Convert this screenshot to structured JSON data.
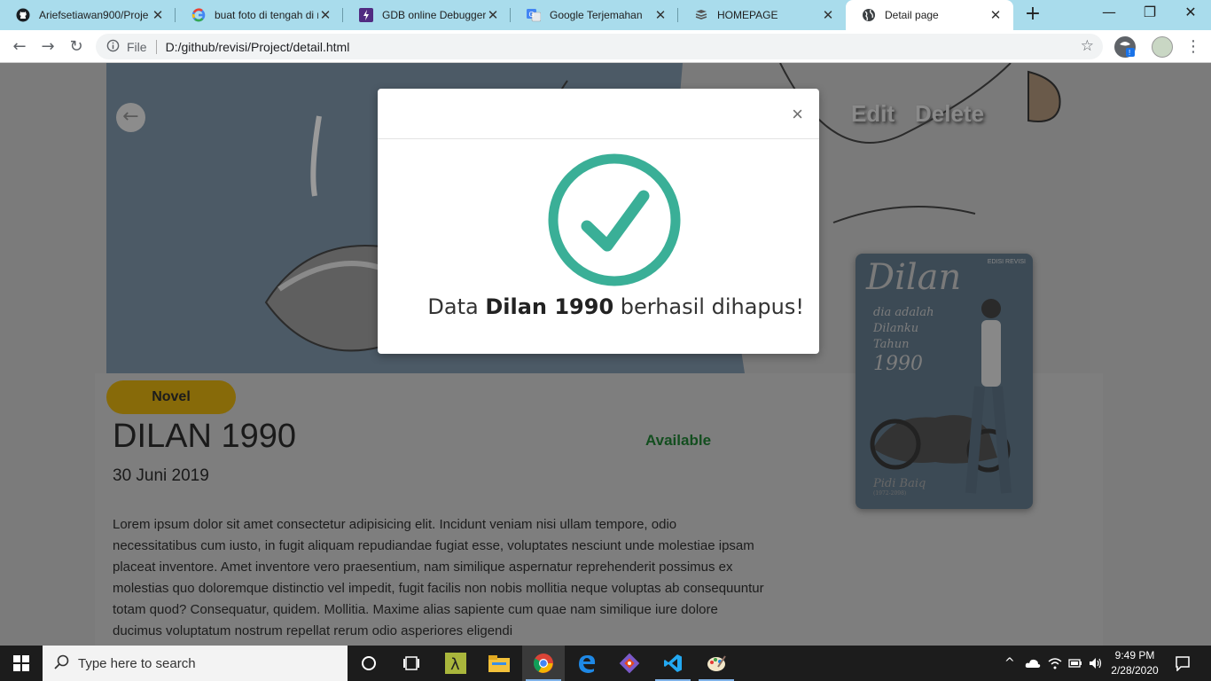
{
  "browser": {
    "tabs": [
      {
        "title": "Ariefsetiawan900/Proje",
        "icon": "github-icon"
      },
      {
        "title": "buat foto di tengah di n",
        "icon": "google-icon"
      },
      {
        "title": "GDB online Debugger |",
        "icon": "gdb-icon"
      },
      {
        "title": "Google Terjemahan",
        "icon": "google-translate-icon"
      },
      {
        "title": "HOMEPAGE",
        "icon": "book-icon"
      },
      {
        "title": "Detail page",
        "icon": "globe-icon"
      }
    ],
    "active_tab_index": 5,
    "address": {
      "protocol_label": "File",
      "url": "D:/github/revisi/Project/detail.html"
    }
  },
  "page": {
    "hero_actions": {
      "edit": "Edit",
      "delete": "Delete"
    },
    "category_badge": "Novel",
    "book_title": "DILAN 1990",
    "date": "30 Juni 2019",
    "status": "Available",
    "description": "Lorem ipsum dolor sit amet consectetur adipisicing elit. Incidunt veniam nisi ullam tempore, odio necessitatibus cum iusto, in fugit aliquam repudiandae fugiat esse, voluptates nesciunt unde molestiae ipsam placeat inventore. Amet inventore vero praesentium, nam similique aspernatur reprehenderit possimus ex molestias quo doloremque distinctio vel impedit, fugit facilis non nobis mollitia neque voluptas ab consequuntur totam quod? Consequatur, quidem. Mollitia. Maxime alias sapiente cum quae nam similique iure dolore ducimus voluptatum nostrum repellat rerum odio asperiores eligendi",
    "cover": {
      "title": "Dilan",
      "edition": "EDISI REVISI",
      "subtitle_lines": [
        "dia adalah",
        "Dilanku",
        "Tahun",
        "1990"
      ],
      "author": "Pidi Baiq",
      "author_years": "(1972-2098)"
    }
  },
  "modal": {
    "close_label": "×",
    "message_prefix": "Data ",
    "message_bold": "Dilan 1990",
    "message_suffix": " berhasil dihapus!",
    "accent_color": "#3aaf97"
  },
  "taskbar": {
    "search_placeholder": "Type here to search",
    "time": "9:49 PM",
    "date": "2/28/2020"
  }
}
